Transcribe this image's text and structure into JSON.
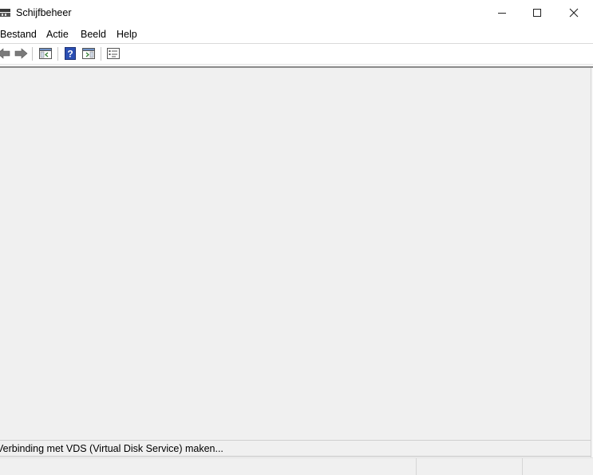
{
  "window": {
    "title": "Schijfbeheer",
    "icon": "disk-management-icon",
    "controls": {
      "minimize": "minimize-icon",
      "maximize": "maximize-icon",
      "close": "close-icon"
    }
  },
  "menu": {
    "items": [
      {
        "label": "Bestand"
      },
      {
        "label": "Actie"
      },
      {
        "label": "Beeld"
      },
      {
        "label": "Help"
      }
    ]
  },
  "toolbar": {
    "buttons": [
      {
        "icon": "back-arrow-icon"
      },
      {
        "icon": "forward-arrow-icon"
      },
      {
        "icon": "show-hide-console-tree-icon"
      },
      {
        "icon": "help-icon"
      },
      {
        "icon": "show-hide-action-pane-icon"
      },
      {
        "icon": "properties-icon"
      }
    ]
  },
  "status": {
    "message": "Verbinding met VDS (Virtual Disk Service) maken..."
  },
  "colors": {
    "window_bg": "#f0f0f0",
    "bar_bg": "#ffffff",
    "help_blue": "#2b4fb3",
    "arrow_gray": "#6f6f6f"
  }
}
